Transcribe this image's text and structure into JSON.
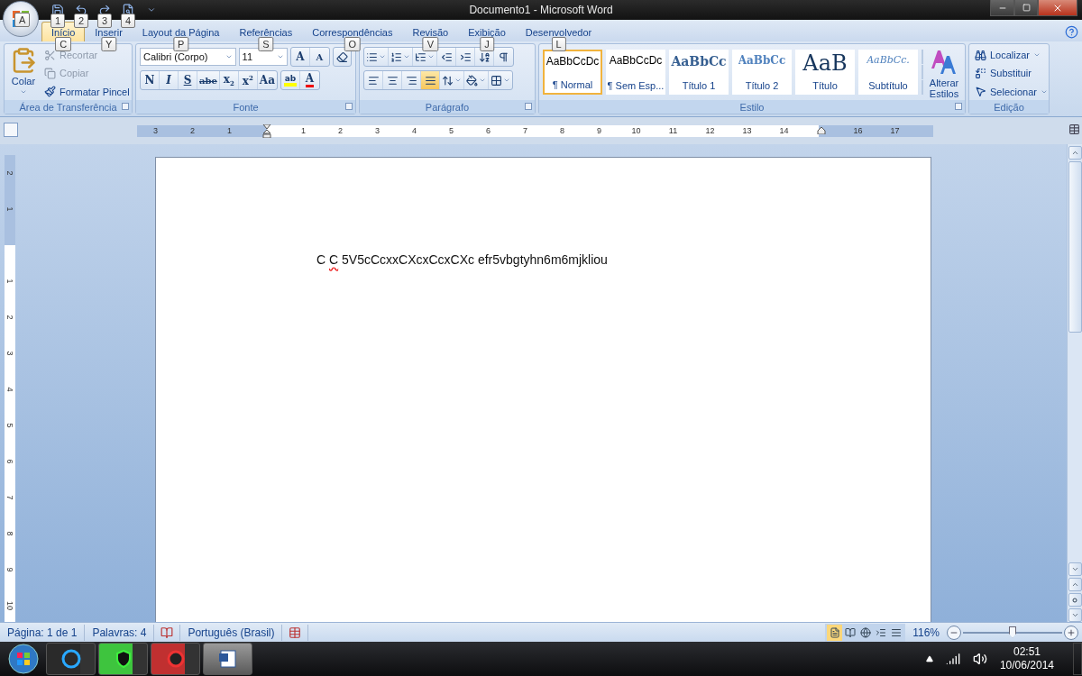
{
  "window": {
    "title": "Documento1 - Microsoft Word",
    "office_button_keytip": "A"
  },
  "quick_access": [
    {
      "kind": "save",
      "keytip": "1"
    },
    {
      "kind": "undo",
      "keytip": "2"
    },
    {
      "kind": "redo",
      "keytip": "3"
    },
    {
      "kind": "preview",
      "keytip": "4"
    }
  ],
  "tabs": [
    {
      "label": "Início",
      "keytip": "C",
      "selected": true
    },
    {
      "label": "Inserir",
      "keytip": "Y",
      "selected": false
    },
    {
      "label": "Layout da Página",
      "keytip": "P",
      "selected": false
    },
    {
      "label": "Referências",
      "keytip": "S",
      "selected": false
    },
    {
      "label": "Correspondências",
      "keytip": "O",
      "selected": false
    },
    {
      "label": "Revisão",
      "keytip": "V",
      "selected": false
    },
    {
      "label": "Exibição",
      "keytip": "J",
      "selected": false
    },
    {
      "label": "Desenvolvedor",
      "keytip": "L",
      "selected": false
    }
  ],
  "clipboard": {
    "title": "Área de Transferência",
    "paste": "Colar",
    "items": [
      {
        "kind": "cut",
        "label": "Recortar",
        "disabled": true
      },
      {
        "kind": "copy",
        "label": "Copiar",
        "disabled": true
      },
      {
        "kind": "painter",
        "label": "Formatar Pincel",
        "disabled": false
      }
    ]
  },
  "font": {
    "title": "Fonte",
    "family": "Calibri (Corpo)",
    "size": "11",
    "grow": "A",
    "shrink": "A",
    "buttons": [
      {
        "kind": "bold",
        "label": "N",
        "selected": false
      },
      {
        "kind": "italic",
        "label": "I",
        "selected": false
      },
      {
        "kind": "underline",
        "label": "S",
        "selected": false
      },
      {
        "kind": "strike",
        "label": "abe",
        "selected": false
      },
      {
        "kind": "sub",
        "label": "x",
        "index": "2",
        "selected": false
      },
      {
        "kind": "sup",
        "label": "x",
        "index": "2",
        "selected": false
      },
      {
        "kind": "case",
        "label": "Aa",
        "selected": false
      }
    ],
    "highlight": "ab",
    "color_label": "A"
  },
  "paragraph": {
    "title": "Parágrafo",
    "row1": [
      {
        "kind": "bullets",
        "selected": false
      },
      {
        "kind": "numbering",
        "selected": false
      },
      {
        "kind": "multilevel",
        "selected": false
      },
      {
        "kind": "outdent",
        "selected": false
      },
      {
        "kind": "indent",
        "selected": false
      },
      {
        "kind": "sort",
        "selected": false
      },
      {
        "kind": "pilcrow",
        "selected": false
      }
    ],
    "row2": [
      {
        "kind": "left",
        "selected": false
      },
      {
        "kind": "center",
        "selected": false
      },
      {
        "kind": "right",
        "selected": false
      },
      {
        "kind": "justify",
        "selected": true
      },
      {
        "kind": "spacing",
        "selected": false
      },
      {
        "kind": "shading",
        "selected": false
      },
      {
        "kind": "borders",
        "selected": false
      }
    ]
  },
  "styles": {
    "title": "Estilo",
    "items": [
      {
        "preview": "AaBbCcDc",
        "name": "¶ Normal",
        "kind": "normal",
        "selected": true
      },
      {
        "preview": "AaBbCcDc",
        "name": "¶ Sem Esp...",
        "kind": "normal",
        "selected": false
      },
      {
        "preview": "AaBbCc",
        "name": "Título 1",
        "kind": "heading1",
        "selected": false
      },
      {
        "preview": "AaBbCc",
        "name": "Título 2",
        "kind": "heading2",
        "selected": false
      },
      {
        "preview": "AaB",
        "name": "Título",
        "kind": "title",
        "selected": false
      },
      {
        "preview": "AaBbCc.",
        "name": "Subtítulo",
        "kind": "subtitle",
        "selected": false
      }
    ],
    "change_label": "Alterar Estilos"
  },
  "editing": {
    "title": "Edição",
    "items": [
      {
        "kind": "find",
        "label": "Localizar",
        "caret": true
      },
      {
        "kind": "replace",
        "label": "Substituir",
        "caret": false
      },
      {
        "kind": "select",
        "label": "Selecionar",
        "caret": true
      }
    ]
  },
  "horizontal_ruler": [
    {
      "kind": "number",
      "label": "3"
    },
    {
      "kind": "number",
      "label": "2"
    },
    {
      "kind": "number",
      "label": "1"
    },
    {
      "kind": "indent"
    },
    {
      "kind": "number",
      "label": "1"
    },
    {
      "kind": "number",
      "label": "2"
    },
    {
      "kind": "number",
      "label": "3"
    },
    {
      "kind": "number",
      "label": "4"
    },
    {
      "kind": "number",
      "label": "5"
    },
    {
      "kind": "number",
      "label": "6"
    },
    {
      "kind": "number",
      "label": "7"
    },
    {
      "kind": "number",
      "label": "8"
    },
    {
      "kind": "number",
      "label": "9"
    },
    {
      "kind": "number",
      "label": "10"
    },
    {
      "kind": "number",
      "label": "11"
    },
    {
      "kind": "number",
      "label": "12"
    },
    {
      "kind": "number",
      "label": "13"
    },
    {
      "kind": "number",
      "label": "14"
    },
    {
      "kind": "margin"
    },
    {
      "kind": "number",
      "label": "16"
    },
    {
      "kind": "number",
      "label": "17"
    }
  ],
  "vertical_ruler": [
    {
      "kind": "number",
      "label": "2"
    },
    {
      "kind": "number",
      "label": "1"
    },
    {
      "kind": "margin"
    },
    {
      "kind": "number",
      "label": "1"
    },
    {
      "kind": "number",
      "label": "2"
    },
    {
      "kind": "number",
      "label": "3"
    },
    {
      "kind": "number",
      "label": "4"
    },
    {
      "kind": "number",
      "label": "5"
    },
    {
      "kind": "number",
      "label": "6"
    },
    {
      "kind": "number",
      "label": "7"
    },
    {
      "kind": "number",
      "label": "8"
    },
    {
      "kind": "number",
      "label": "9"
    },
    {
      "kind": "number",
      "label": "10"
    }
  ],
  "document": {
    "segments": [
      {
        "text": "C ",
        "misspelled": false
      },
      {
        "text": "C",
        "misspelled": true
      },
      {
        "text": " 5V5cCcxxCXcxCcxCXc efr5vbgtyhn6m6mjkliou",
        "misspelled": false
      }
    ]
  },
  "status_bar": {
    "page": "Página: 1 de 1",
    "words": "Palavras: 4",
    "language": "Português (Brasil)",
    "views": [
      {
        "kind": "print",
        "selected": true
      },
      {
        "kind": "reading",
        "selected": false
      },
      {
        "kind": "web",
        "selected": false
      },
      {
        "kind": "outline",
        "selected": false
      },
      {
        "kind": "draft",
        "selected": false
      }
    ],
    "zoom": "116%",
    "zoom_slider": {
      "level": 0.5
    }
  },
  "taskbar": {
    "apps": [
      {
        "kind": "cleaner",
        "color": "#2a2a2a",
        "selected": false
      },
      {
        "kind": "shield",
        "color": "#3ec43e",
        "selected": false
      },
      {
        "kind": "gear",
        "color": "#c03030",
        "selected": false
      },
      {
        "kind": "word",
        "color": "#6a6a6a",
        "selected": true
      }
    ],
    "time": "02:51",
    "date": "10/06/2014"
  }
}
